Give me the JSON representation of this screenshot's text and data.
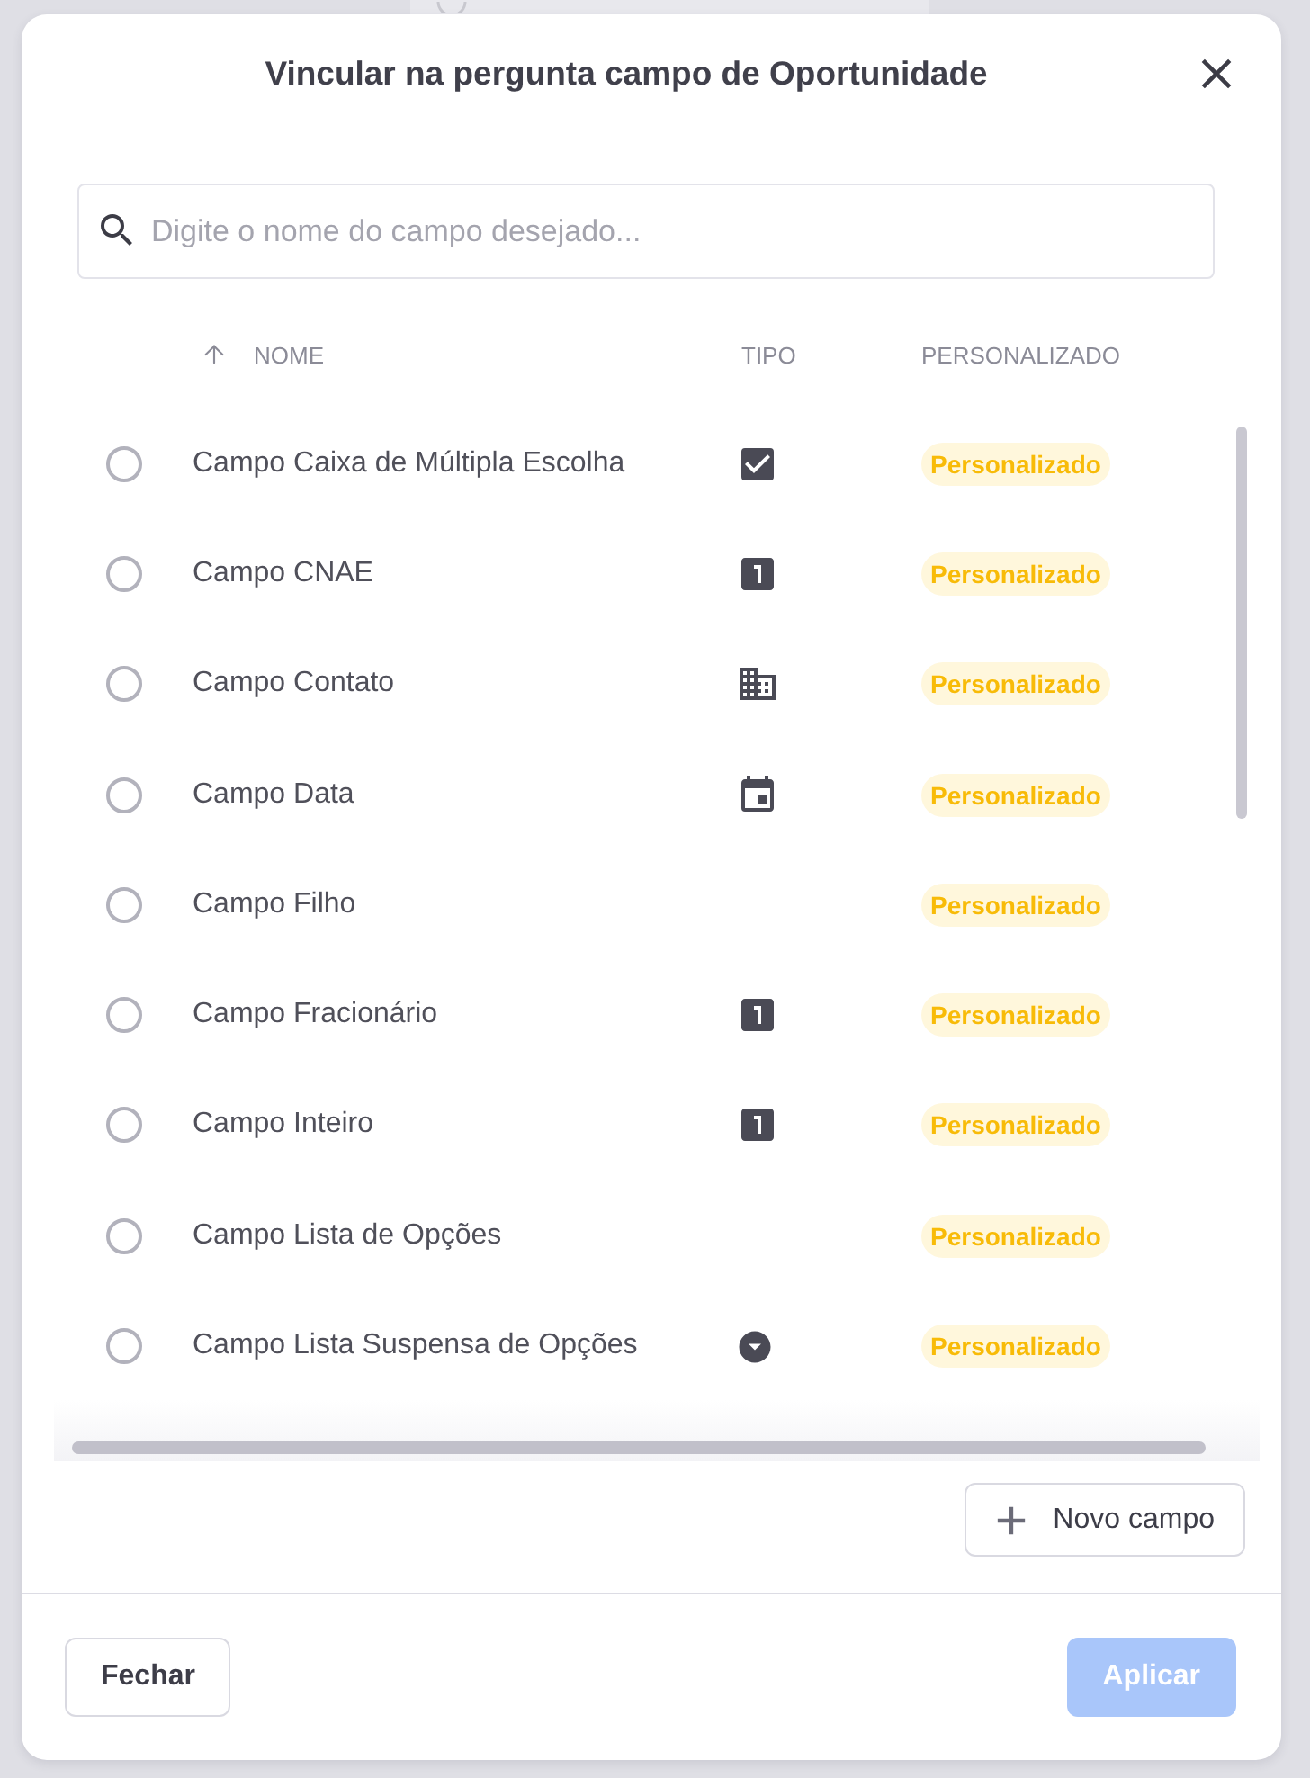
{
  "dialog": {
    "title": "Vincular na pergunta campo de Oportunidade",
    "search": {
      "placeholder": "Digite o nome do campo desejado..."
    },
    "table": {
      "columns": [
        {
          "label": "NOME",
          "sorted": true
        },
        {
          "label": "TIPO",
          "sorted": false
        },
        {
          "label": "PERSONALIZADO",
          "sorted": false
        }
      ],
      "rows": [
        {
          "name": "Campo Caixa de Múltipla Escolha",
          "kind": "checkbox",
          "badge": "Personalizado",
          "selected": false
        },
        {
          "name": "Campo CNAE",
          "kind": "number",
          "badge": "Personalizado",
          "selected": false
        },
        {
          "name": "Campo Contato",
          "kind": "building",
          "badge": "Personalizado",
          "selected": false
        },
        {
          "name": "Campo Data",
          "kind": "calendar",
          "badge": "Personalizado",
          "selected": false
        },
        {
          "name": "Campo Filho",
          "kind": "none",
          "badge": "Personalizado",
          "selected": false
        },
        {
          "name": "Campo Fracionário",
          "kind": "number",
          "badge": "Personalizado",
          "selected": false
        },
        {
          "name": "Campo Inteiro",
          "kind": "number",
          "badge": "Personalizado",
          "selected": false
        },
        {
          "name": "Campo Lista de Opções",
          "kind": "none",
          "badge": "Personalizado",
          "selected": false
        },
        {
          "name": "Campo Lista Suspensa de Opções",
          "kind": "dropdown",
          "badge": "Personalizado",
          "selected": false
        }
      ]
    },
    "new_field_button": "Novo campo",
    "buttons": [
      {
        "label": "Fechar",
        "kind": "secondary",
        "disabled": false
      },
      {
        "label": "Aplicar",
        "kind": "primary",
        "disabled": true
      }
    ]
  }
}
